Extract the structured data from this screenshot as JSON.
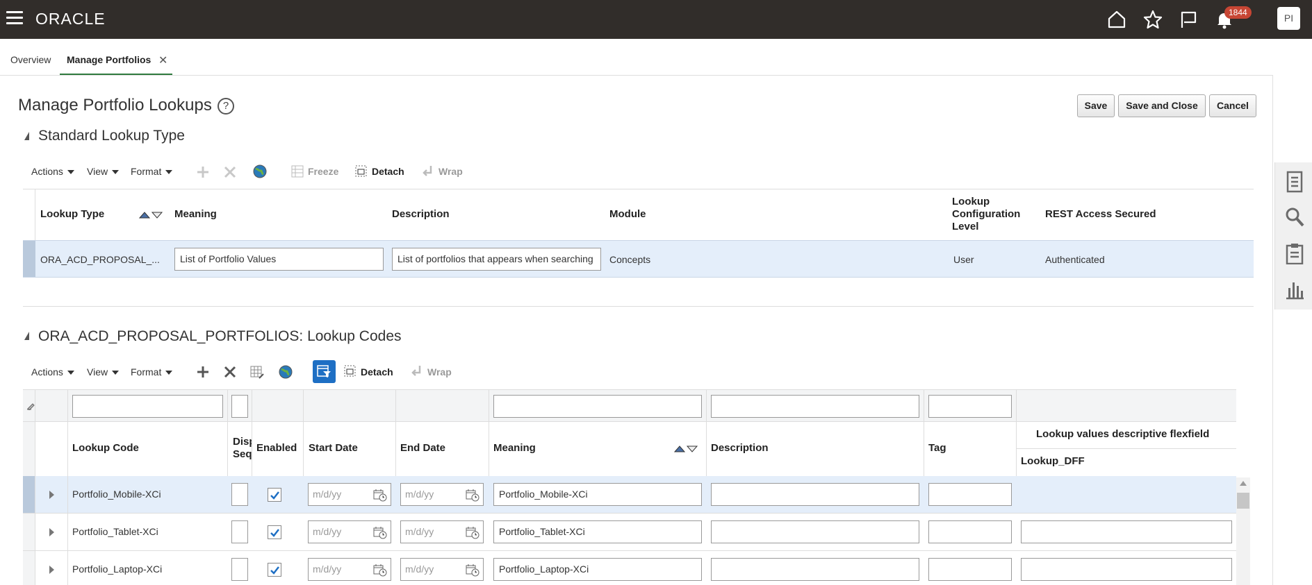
{
  "header": {
    "logo": "ORACLE",
    "notification_count": "1844",
    "avatar_initials": "PI"
  },
  "tabs": [
    {
      "label": "Overview"
    },
    {
      "label": "Manage Portfolios"
    }
  ],
  "page": {
    "title": "Manage Portfolio Lookups",
    "help": "?",
    "buttons": {
      "save": "Save",
      "save_close": "Save and Close",
      "cancel": "Cancel"
    }
  },
  "section1": {
    "title": "Standard Lookup Type",
    "toolbar": {
      "actions": "Actions",
      "view": "View",
      "format": "Format",
      "freeze": "Freeze",
      "detach": "Detach",
      "wrap": "Wrap"
    },
    "columns": {
      "lookup_type": "Lookup Type",
      "meaning": "Meaning",
      "description": "Description",
      "module": "Module",
      "config_level": "Lookup Configuration Level",
      "rest": "REST Access Secured"
    },
    "row": {
      "lookup_type": "ORA_ACD_PROPOSAL_...",
      "meaning": "List of Portfolio Values",
      "description": "List of portfolios that appears when searching",
      "module": "Concepts",
      "config_level": "User",
      "rest": "Authenticated"
    }
  },
  "section2": {
    "title": "ORA_ACD_PROPOSAL_PORTFOLIOS: Lookup Codes",
    "toolbar": {
      "actions": "Actions",
      "view": "View",
      "format": "Format",
      "detach": "Detach",
      "wrap": "Wrap"
    },
    "columns": {
      "lookup_code": "Lookup Code",
      "disp_seq_top": "Disp",
      "disp_seq_bottom": "Seq",
      "enabled": "Enabled",
      "start_date": "Start Date",
      "end_date": "End Date",
      "meaning": "Meaning",
      "description": "Description",
      "tag": "Tag",
      "dff_group": "Lookup values descriptive flexfield",
      "dff": "Lookup_DFF"
    },
    "date_placeholder": "m/d/yy",
    "rows": [
      {
        "code": "Portfolio_Mobile-XCi",
        "meaning": "Portfolio_Mobile-XCi",
        "enabled": true
      },
      {
        "code": "Portfolio_Tablet-XCi",
        "meaning": "Portfolio_Tablet-XCi",
        "enabled": true
      },
      {
        "code": "Portfolio_Laptop-XCi",
        "meaning": "Portfolio_Laptop-XCi",
        "enabled": true
      }
    ]
  },
  "colors": {
    "header_bg": "#312d2a",
    "tab_accent": "#2f7a3d",
    "badge": "#c74634",
    "selected_row": "#e4eefa",
    "active_toggle": "#1e6fc4"
  }
}
